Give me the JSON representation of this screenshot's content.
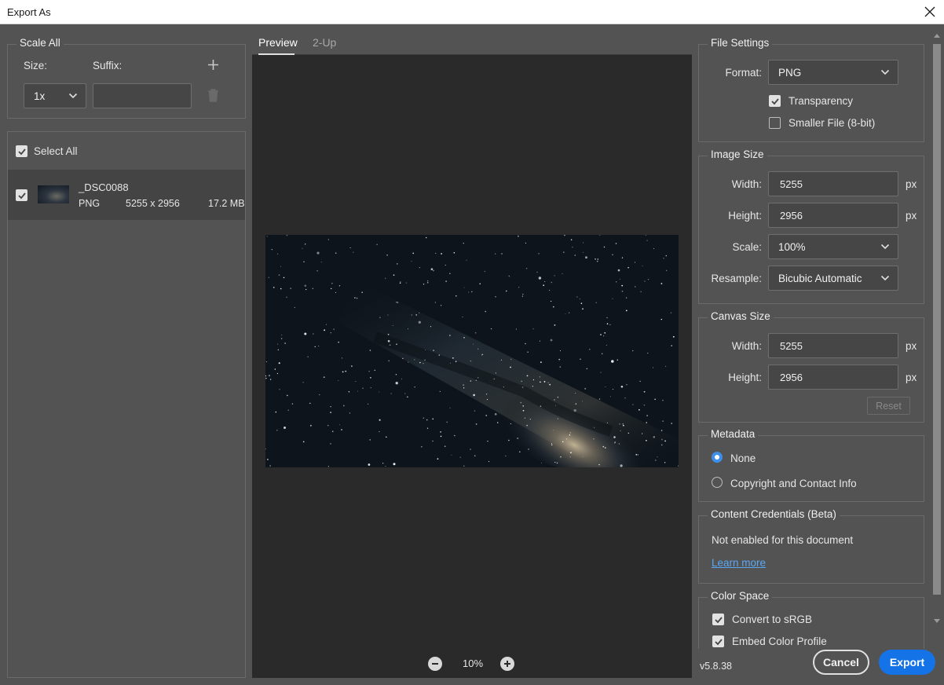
{
  "window": {
    "title": "Export As"
  },
  "scale_all": {
    "title": "Scale All",
    "size_label": "Size:",
    "suffix_label": "Suffix:",
    "size_value": "1x",
    "suffix_value": ""
  },
  "assets": {
    "select_all_label": "Select All",
    "items": [
      {
        "name": "_DSC0088",
        "format": "PNG",
        "dimensions": "5255 x 2956",
        "size": "17.2 MB",
        "checked": true
      }
    ]
  },
  "tabs": [
    {
      "label": "Preview",
      "active": true
    },
    {
      "label": "2-Up",
      "active": false
    }
  ],
  "zoom": {
    "value": "10%"
  },
  "file_settings": {
    "title": "File Settings",
    "format_label": "Format:",
    "format_value": "PNG",
    "transparency_label": "Transparency",
    "smaller_file_label": "Smaller File (8-bit)"
  },
  "image_size": {
    "title": "Image Size",
    "width_label": "Width:",
    "width_value": "5255",
    "height_label": "Height:",
    "height_value": "2956",
    "unit": "px",
    "scale_label": "Scale:",
    "scale_value": "100%",
    "resample_label": "Resample:",
    "resample_value": "Bicubic Automatic"
  },
  "canvas_size": {
    "title": "Canvas Size",
    "width_label": "Width:",
    "width_value": "5255",
    "height_label": "Height:",
    "height_value": "2956",
    "unit": "px",
    "reset_label": "Reset"
  },
  "metadata": {
    "title": "Metadata",
    "none_label": "None",
    "copyright_label": "Copyright and Contact Info"
  },
  "content_credentials": {
    "title": "Content Credentials (Beta)",
    "status": "Not enabled for this document",
    "learn_more": "Learn more"
  },
  "color_space": {
    "title": "Color Space",
    "convert_label": "Convert to sRGB",
    "embed_label": "Embed Color Profile"
  },
  "footer": {
    "version": "v5.8.38",
    "cancel_label": "Cancel",
    "export_label": "Export"
  },
  "colors": {
    "accent": "#1473e6",
    "radio": "#3d8fe8",
    "link": "#5aa7f2",
    "dialog_bg": "#535353",
    "preview_bg": "#2a2a2a"
  }
}
